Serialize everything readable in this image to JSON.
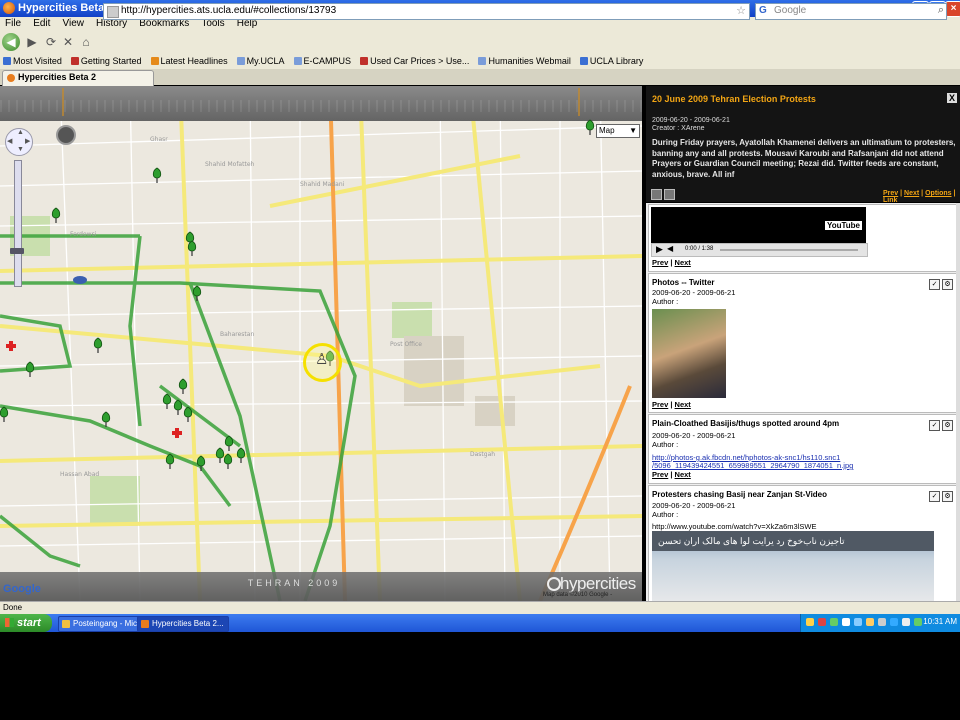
{
  "window": {
    "title": "Hypercities Beta 2 - Mozilla Firefox"
  },
  "menu": [
    "File",
    "Edit",
    "View",
    "History",
    "Bookmarks",
    "Tools",
    "Help"
  ],
  "nav": {
    "url": "http://hypercities.ats.ucla.edu/#collections/13793",
    "search_placeholder": "Google"
  },
  "bookmarks": [
    {
      "label": "Most Visited",
      "color": "#3b6fd3"
    },
    {
      "label": "Getting Started",
      "color": "#c0302a"
    },
    {
      "label": "Latest Headlines",
      "color": "#e58a1a"
    },
    {
      "label": "My.UCLA",
      "color": "#7a9cd9"
    },
    {
      "label": "E-CAMPUS",
      "color": "#7a9cd9"
    },
    {
      "label": "Used Car Prices > Use...",
      "color": "#c0302a"
    },
    {
      "label": "Humanities Webmail",
      "color": "#7a9cd9"
    },
    {
      "label": "UCLA Library",
      "color": "#3b6fd3"
    }
  ],
  "tab": {
    "label": "Hypercities Beta 2"
  },
  "map": {
    "type_select": "Map",
    "city_label": "TEHRAN 2009",
    "brand": "hypercities",
    "copyright": "Map data ©2010 Google -",
    "google": "Google"
  },
  "panel": {
    "title": "20 June 2009 Tehran Election Protests",
    "dates": "2009-06-20 - 2009-06-21",
    "creator": "Creator : XArene",
    "description": "During Friday prayers, Ayatollah Khamenei delivers an ultimatium to protesters, banning any and all protests. Mousavi Karoubi and Rafsanjani did not attend Prayers or Guardian Council meeting; Rezai did. Twitter feeds are constant, anxious, brave. All inf",
    "close": "X",
    "links": {
      "prev": "Prev",
      "next": "Next",
      "options": "Options",
      "link": "Link"
    }
  },
  "feed": {
    "video": {
      "time": "0:00 / 1:38",
      "logo": "YouTube",
      "prev": "Prev",
      "next": "Next"
    },
    "items": [
      {
        "title": "Photos -- Twitter",
        "dates": "2009-06-20 - 2009-06-21",
        "author": "Author :",
        "prev": "Prev",
        "next": "Next"
      },
      {
        "title": "Plain-Cloathed Basijis/thugs spotted around 4pm",
        "dates": "2009-06-20 - 2009-06-21",
        "author": "Author :",
        "link1": "http://photos-g.ak.fbcdn.net/hphotos-ak-snc1/hs110.snc1",
        "link2": "/5096_119439424551_659989551_2964790_1874051_n.jpg",
        "prev": "Prev",
        "next": "Next"
      },
      {
        "title": "Protesters chasing Basij near Zanjan St-Video",
        "dates": "2009-06-20 - 2009-06-21",
        "author": "Author :",
        "link1": "http://www.youtube.com/watch?v=XkZa6m3lSWE",
        "video_caption": "تاجیزن ناب‌خوخ رد یرایت لوا های مالک اران تحسن"
      }
    ]
  },
  "status": "Done",
  "taskbar": {
    "start": "start",
    "buttons": [
      "Posteingang - Mic...",
      "Hypercities Beta 2..."
    ],
    "clock": "10:31 AM"
  },
  "colors": {
    "accent": "#f2a514",
    "title_bar": "#1f56d6",
    "link": "#1a2fb0"
  }
}
